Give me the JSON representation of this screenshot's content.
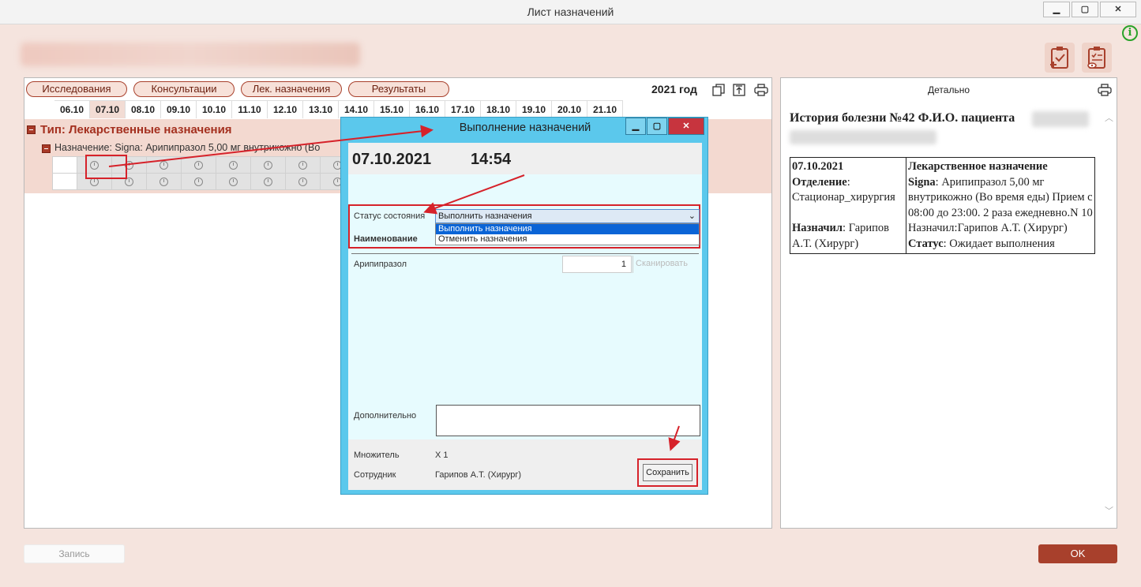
{
  "window": {
    "title": "Лист назначений"
  },
  "tabs": [
    "Исследования",
    "Консультации",
    "Лек. назначения",
    "Результаты"
  ],
  "year": "2021 год",
  "dates": [
    "06.10",
    "07.10",
    "08.10",
    "09.10",
    "10.10",
    "11.10",
    "12.10",
    "13.10",
    "14.10",
    "15.10",
    "16.10",
    "17.10",
    "18.10",
    "19.10",
    "20.10",
    "21.10"
  ],
  "type_label": "Тип: Лекарственные назначения",
  "naz_label": "Назначение: Signa: Арипипразол 5,00 мг  внутрикожно (Во",
  "detail": {
    "title": "Детально",
    "history": "История болезни №42 Ф.И.О. пациента",
    "date": "07.10.2021",
    "otd_label": "Отделение",
    "otd_value": "Стационар_хирургия",
    "nazn_label": "Назначил",
    "nazn_value": ": Гарипов А.Т. (Хирург)",
    "type": "Лекарственное назначение",
    "signa_label": "Signa",
    "signa_value": ": Арипипразол 5,00 мг внутрикожно (Во время еды) Прием с 08:00 до 23:00. 2 раза ежедневно.N 10",
    "assigned": "Назначил:Гарипов А.Т. (Хирург)",
    "status_label": "Статус",
    "status_value": ": Ожидает выполнения"
  },
  "buttons": {
    "record": "Запись",
    "ok": "OK"
  },
  "dialog": {
    "title": "Выполнение назначений",
    "date": "07.10.2021",
    "time": "14:54",
    "status_label": "Статус состояния",
    "status_value": "Выполнить назначения",
    "options": [
      "Выполнить назначения",
      "Отменить назначения"
    ],
    "name_label": "Наименование",
    "drug": "Арипипразол",
    "qty": "1",
    "scan": "Сканировать",
    "addl_label": "Дополнительно",
    "mult_label": "Множитель",
    "mult_value": "X 1",
    "staff_label": "Сотрудник",
    "staff_value": "Гарипов А.Т. (Хирург)",
    "save": "Сохранить"
  }
}
